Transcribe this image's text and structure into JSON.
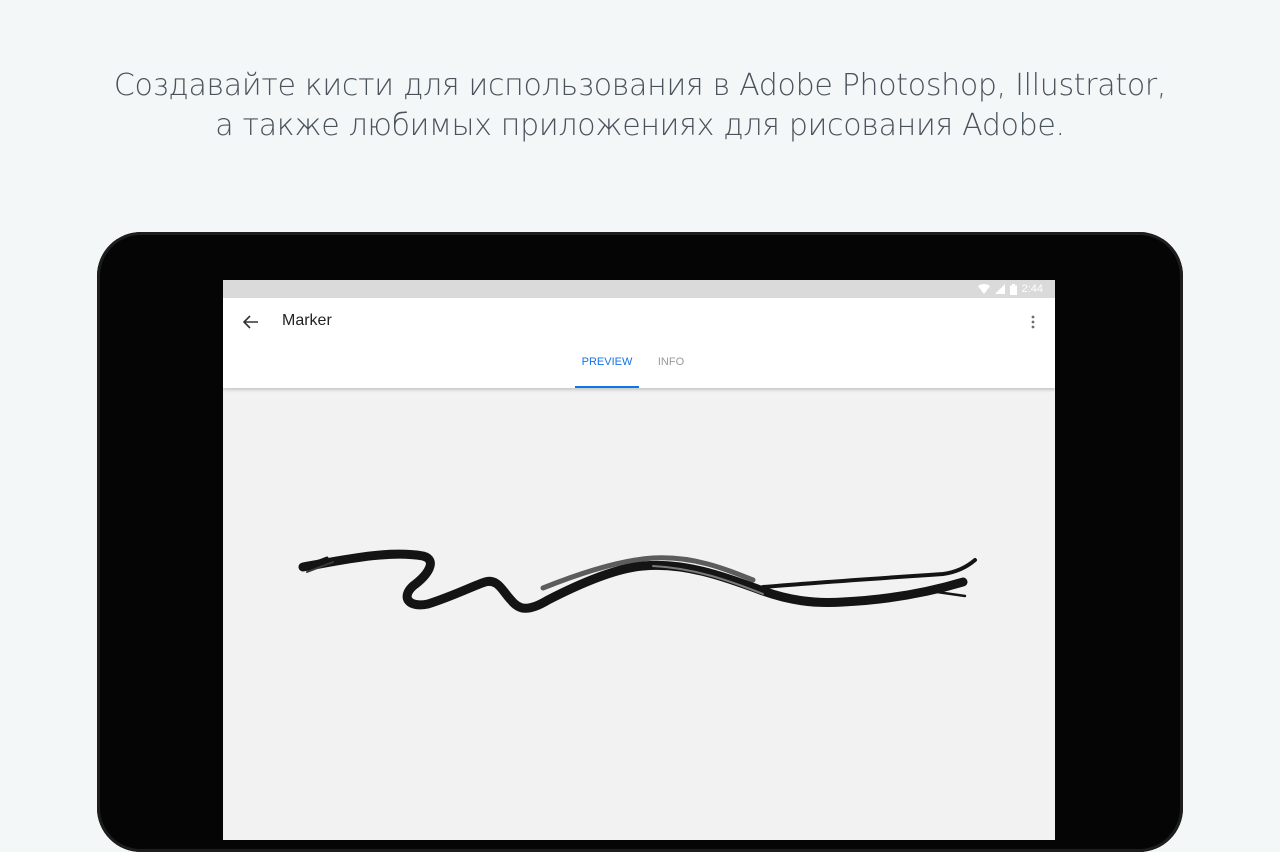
{
  "headline": {
    "line1": "Создавайте кисти для использования в Adobe Photoshop, Illustrator,",
    "line2": "а также любимых приложениях для рисования Adobe."
  },
  "status_bar": {
    "time": "2:44",
    "icons": [
      "wifi-icon",
      "cell-signal-icon",
      "battery-icon"
    ]
  },
  "app_bar": {
    "title": "Marker",
    "back_icon": "arrow-left-icon",
    "menu_icon": "more-vert-icon"
  },
  "tabs": [
    {
      "label": "PREVIEW",
      "active": true
    },
    {
      "label": "INFO",
      "active": false
    }
  ],
  "colors": {
    "background": "#f4f7f8",
    "accent": "#1473e6",
    "headline": "#4a535c",
    "stroke": "#111111"
  }
}
